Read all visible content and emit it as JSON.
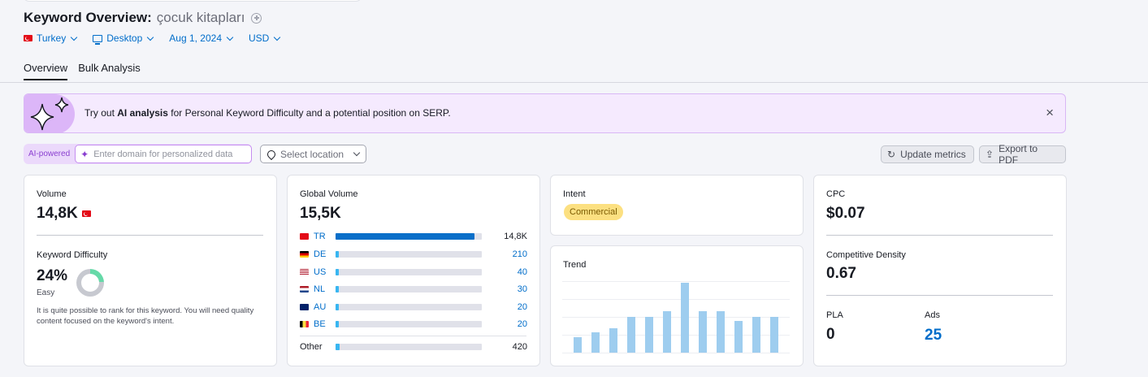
{
  "header": {
    "title": "Keyword Overview:",
    "keyword": "çocuk kitapları"
  },
  "filters": {
    "country": "Turkey",
    "device": "Desktop",
    "date": "Aug 1, 2024",
    "currency": "USD"
  },
  "tabs": [
    {
      "label": "Overview",
      "active": true
    },
    {
      "label": "Bulk Analysis",
      "active": false
    }
  ],
  "banner": {
    "prefix": "Try out ",
    "highlight": "AI analysis",
    "suffix": " for Personal Keyword Difficulty and a potential position on SERP.",
    "close": "×"
  },
  "toolbar": {
    "ai_label": "AI-powered",
    "domain_placeholder": "Enter domain for personalized data",
    "location_placeholder": "Select location",
    "update_label": "Update metrics",
    "export_label": "Export to PDF"
  },
  "volume": {
    "label": "Volume",
    "value": "14,8K"
  },
  "kd": {
    "label": "Keyword Difficulty",
    "value": "24%",
    "level": "Easy",
    "percent": 24,
    "description": "It is quite possible to rank for this keyword. You will need quality content focused on the keyword's intent."
  },
  "global_volume": {
    "label": "Global Volume",
    "value": "15,5K",
    "countries": [
      {
        "code": "TR",
        "value": "14,8K",
        "share": 0.95,
        "flag": "tr",
        "value_color": "#171a22"
      },
      {
        "code": "DE",
        "value": "210",
        "share": 0.014,
        "flag": "de",
        "value_color": "#006dca"
      },
      {
        "code": "US",
        "value": "40",
        "share": 0.008,
        "flag": "us",
        "value_color": "#006dca"
      },
      {
        "code": "NL",
        "value": "30",
        "share": 0.008,
        "flag": "nl",
        "value_color": "#006dca"
      },
      {
        "code": "AU",
        "value": "20",
        "share": 0.008,
        "flag": "au",
        "value_color": "#006dca"
      },
      {
        "code": "BE",
        "value": "20",
        "share": 0.008,
        "flag": "be",
        "value_color": "#006dca"
      }
    ],
    "other": {
      "label": "Other",
      "value": "420",
      "share": 0.027
    }
  },
  "intent": {
    "label": "Intent",
    "value": "Commercial"
  },
  "trend": {
    "label": "Trend",
    "values": [
      0.35,
      0.46,
      0.56,
      0.82,
      0.82,
      0.95,
      1.6,
      0.95,
      0.95,
      0.72,
      0.82,
      0.82
    ]
  },
  "cpc": {
    "label": "CPC",
    "value": "$0.07"
  },
  "competitive_density": {
    "label": "Competitive Density",
    "value": "0.67"
  },
  "pla": {
    "label": "PLA",
    "value": "0"
  },
  "ads": {
    "label": "Ads",
    "value": "25"
  },
  "colors": {
    "accent": "#006dca",
    "bar_main": "#0a6fc9",
    "bar_small": "#38b6f1",
    "trend": "#9ecdef",
    "commercial_badge": "#fce081"
  }
}
